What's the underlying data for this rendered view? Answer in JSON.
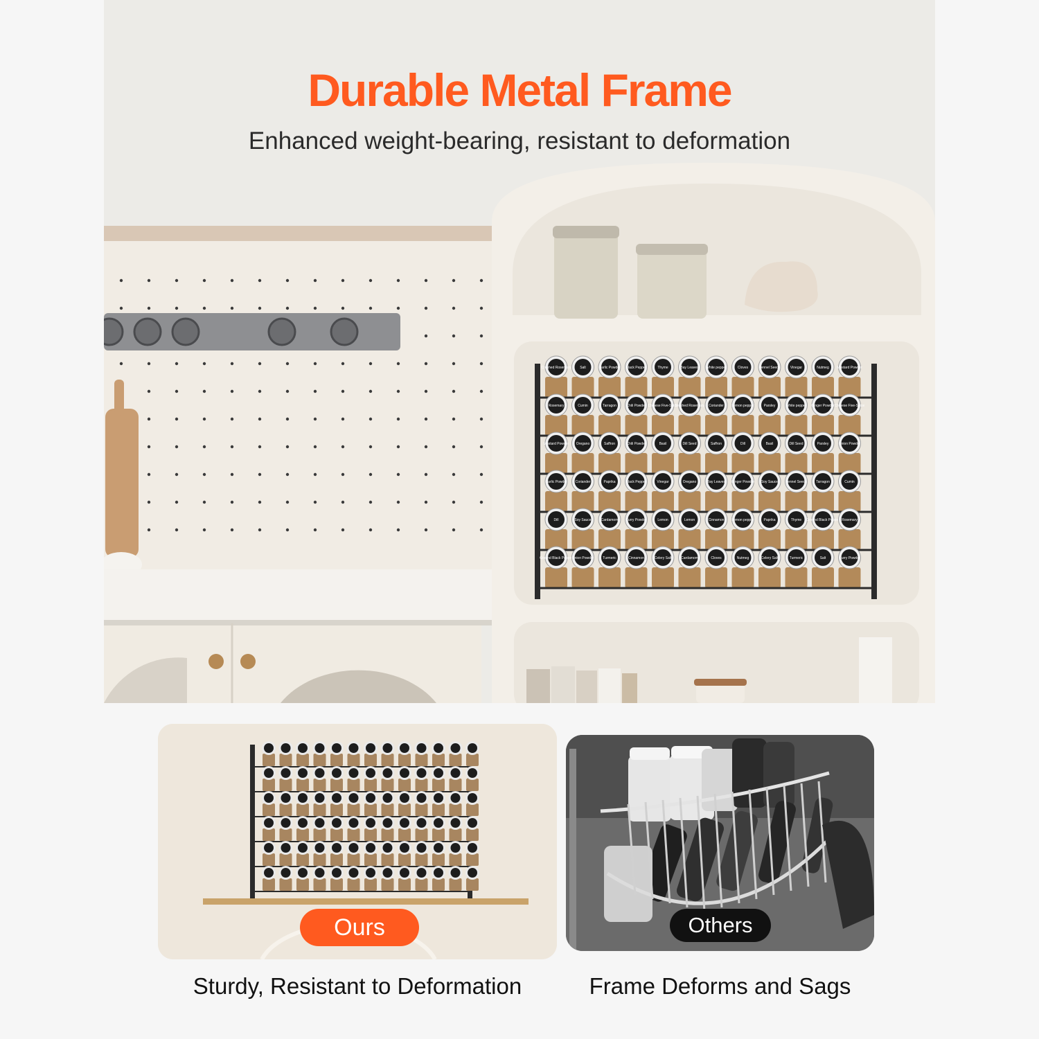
{
  "header": {
    "title": "Durable Metal Frame",
    "subtitle": "Enhanced weight-bearing, resistant to deformation"
  },
  "colors": {
    "accent": "#ff5a1f",
    "dark_badge": "#111111",
    "background": "#f6f6f6"
  },
  "hero_image": {
    "rack_labels": [
      [
        "Crushed Rosemary",
        "Salt",
        "Garlic Powder",
        "Black Pepper",
        "Thyme",
        "Bay Leaves",
        "White pepper",
        "Cloves",
        "Fennel Seeds",
        "Vinegar",
        "Nutmeg",
        "Mustard Powder"
      ],
      [
        "Rosemary",
        "Cumin",
        "Tarragon",
        "Chili Powder",
        "Chinese Five-Spice",
        "Crushed Rosemary",
        "Coriander",
        "Lemon pepper",
        "Parsley",
        "White pepper",
        "Ginger Powder",
        "Chinese Five-Spice"
      ],
      [
        "Mustard Powder",
        "Oregano",
        "Saffron",
        "Chili Powder",
        "Basil",
        "Dill Seed",
        "Saffron",
        "Dill",
        "Basil",
        "Dill Seed",
        "Parsley",
        "Onion Powder"
      ],
      [
        "Garlic Powder",
        "Coriander",
        "Paprika",
        "Black Pepper",
        "Vinegar",
        "Oregano",
        "Bay Leaves",
        "Ginger Powder",
        "Soy Sauce",
        "Fennel Seeds",
        "Tarragon",
        "Cumin"
      ],
      [
        "Dill",
        "Soy Sauce",
        "Cardamom",
        "Curry Powder",
        "Lemon",
        "Lemon",
        "Cinnamon",
        "Lemon pepper",
        "Paprika",
        "Thyme",
        "Ground Black Pepper",
        "Rosemary"
      ],
      [
        "Ground Black Pepper",
        "Onion Powder",
        "Turmeric",
        "Cinnamon",
        "Celery Salt",
        "Cardamom",
        "Cloves",
        "Nutmeg",
        "Celery Salt",
        "Turmeric",
        "Salt",
        "Curry Powder"
      ]
    ]
  },
  "comparison": {
    "ours": {
      "badge": "Ours",
      "caption": "Sturdy, Resistant to Deformation",
      "badge_color": "#ff5a1f"
    },
    "others": {
      "badge": "Others",
      "caption": "Frame Deforms and Sags",
      "badge_color": "#111111"
    }
  }
}
